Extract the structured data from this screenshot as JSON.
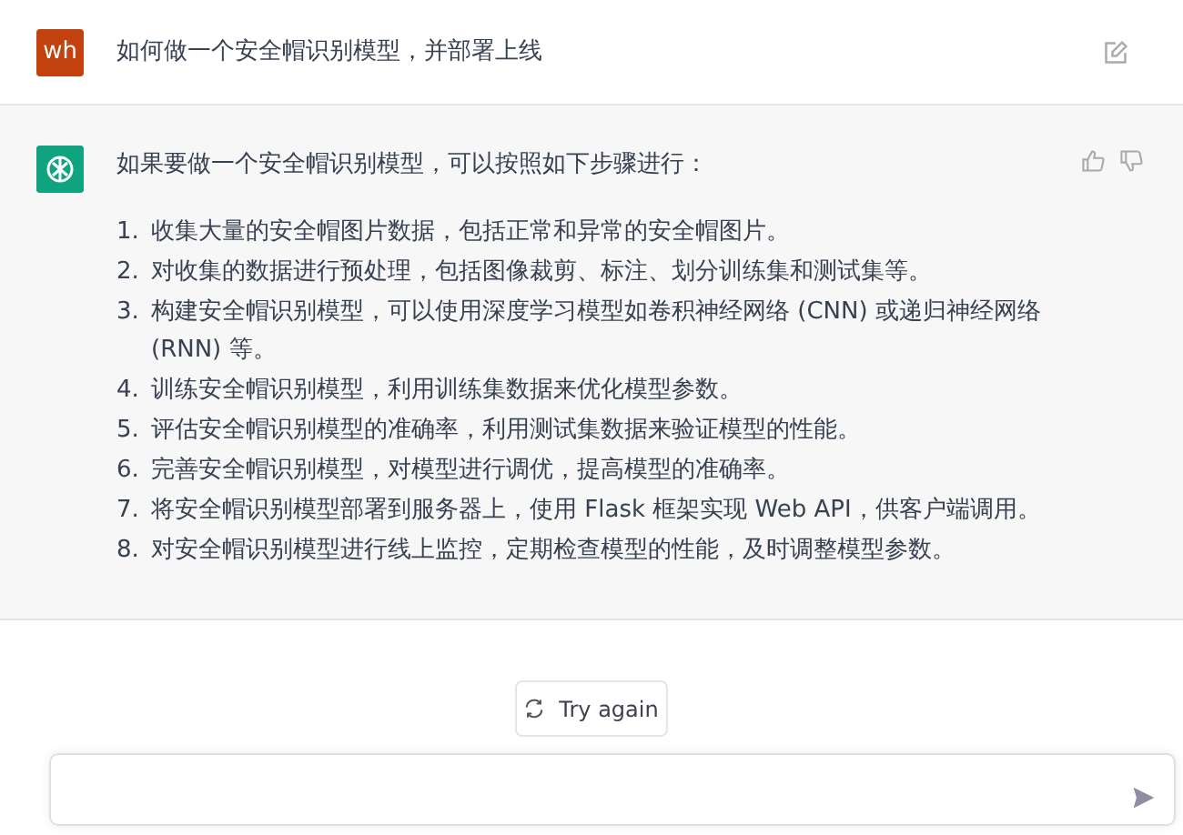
{
  "user_message": {
    "avatar": "wh",
    "text": "如何做一个安全帽识别模型，并部署上线"
  },
  "assistant_message": {
    "intro": "如果要做一个安全帽识别模型，可以按照如下步骤进行：",
    "steps": [
      {
        "number": "1.",
        "text": "收集大量的安全帽图片数据，包括正常和异常的安全帽图片。"
      },
      {
        "number": "2.",
        "text": "对收集的数据进行预处理，包括图像裁剪、标注、划分训练集和测试集等。"
      },
      {
        "number": "3.",
        "text": "构建安全帽识别模型，可以使用深度学习模型如卷积神经网络 (CNN) 或递归神经网络 (RNN) 等。"
      },
      {
        "number": "4.",
        "text": "训练安全帽识别模型，利用训练集数据来优化模型参数。"
      },
      {
        "number": "5.",
        "text": "评估安全帽识别模型的准确率，利用测试集数据来验证模型的性能。"
      },
      {
        "number": "6.",
        "text": "完善安全帽识别模型，对模型进行调优，提高模型的准确率。"
      },
      {
        "number": "7.",
        "text": "将安全帽识别模型部署到服务器上，使用 Flask 框架实现 Web API，供客户端调用。"
      },
      {
        "number": "8.",
        "text": "对安全帽识别模型进行线上监控，定期检查模型的性能，及时调整模型参数。"
      }
    ]
  },
  "try_again_button": "Try again"
}
